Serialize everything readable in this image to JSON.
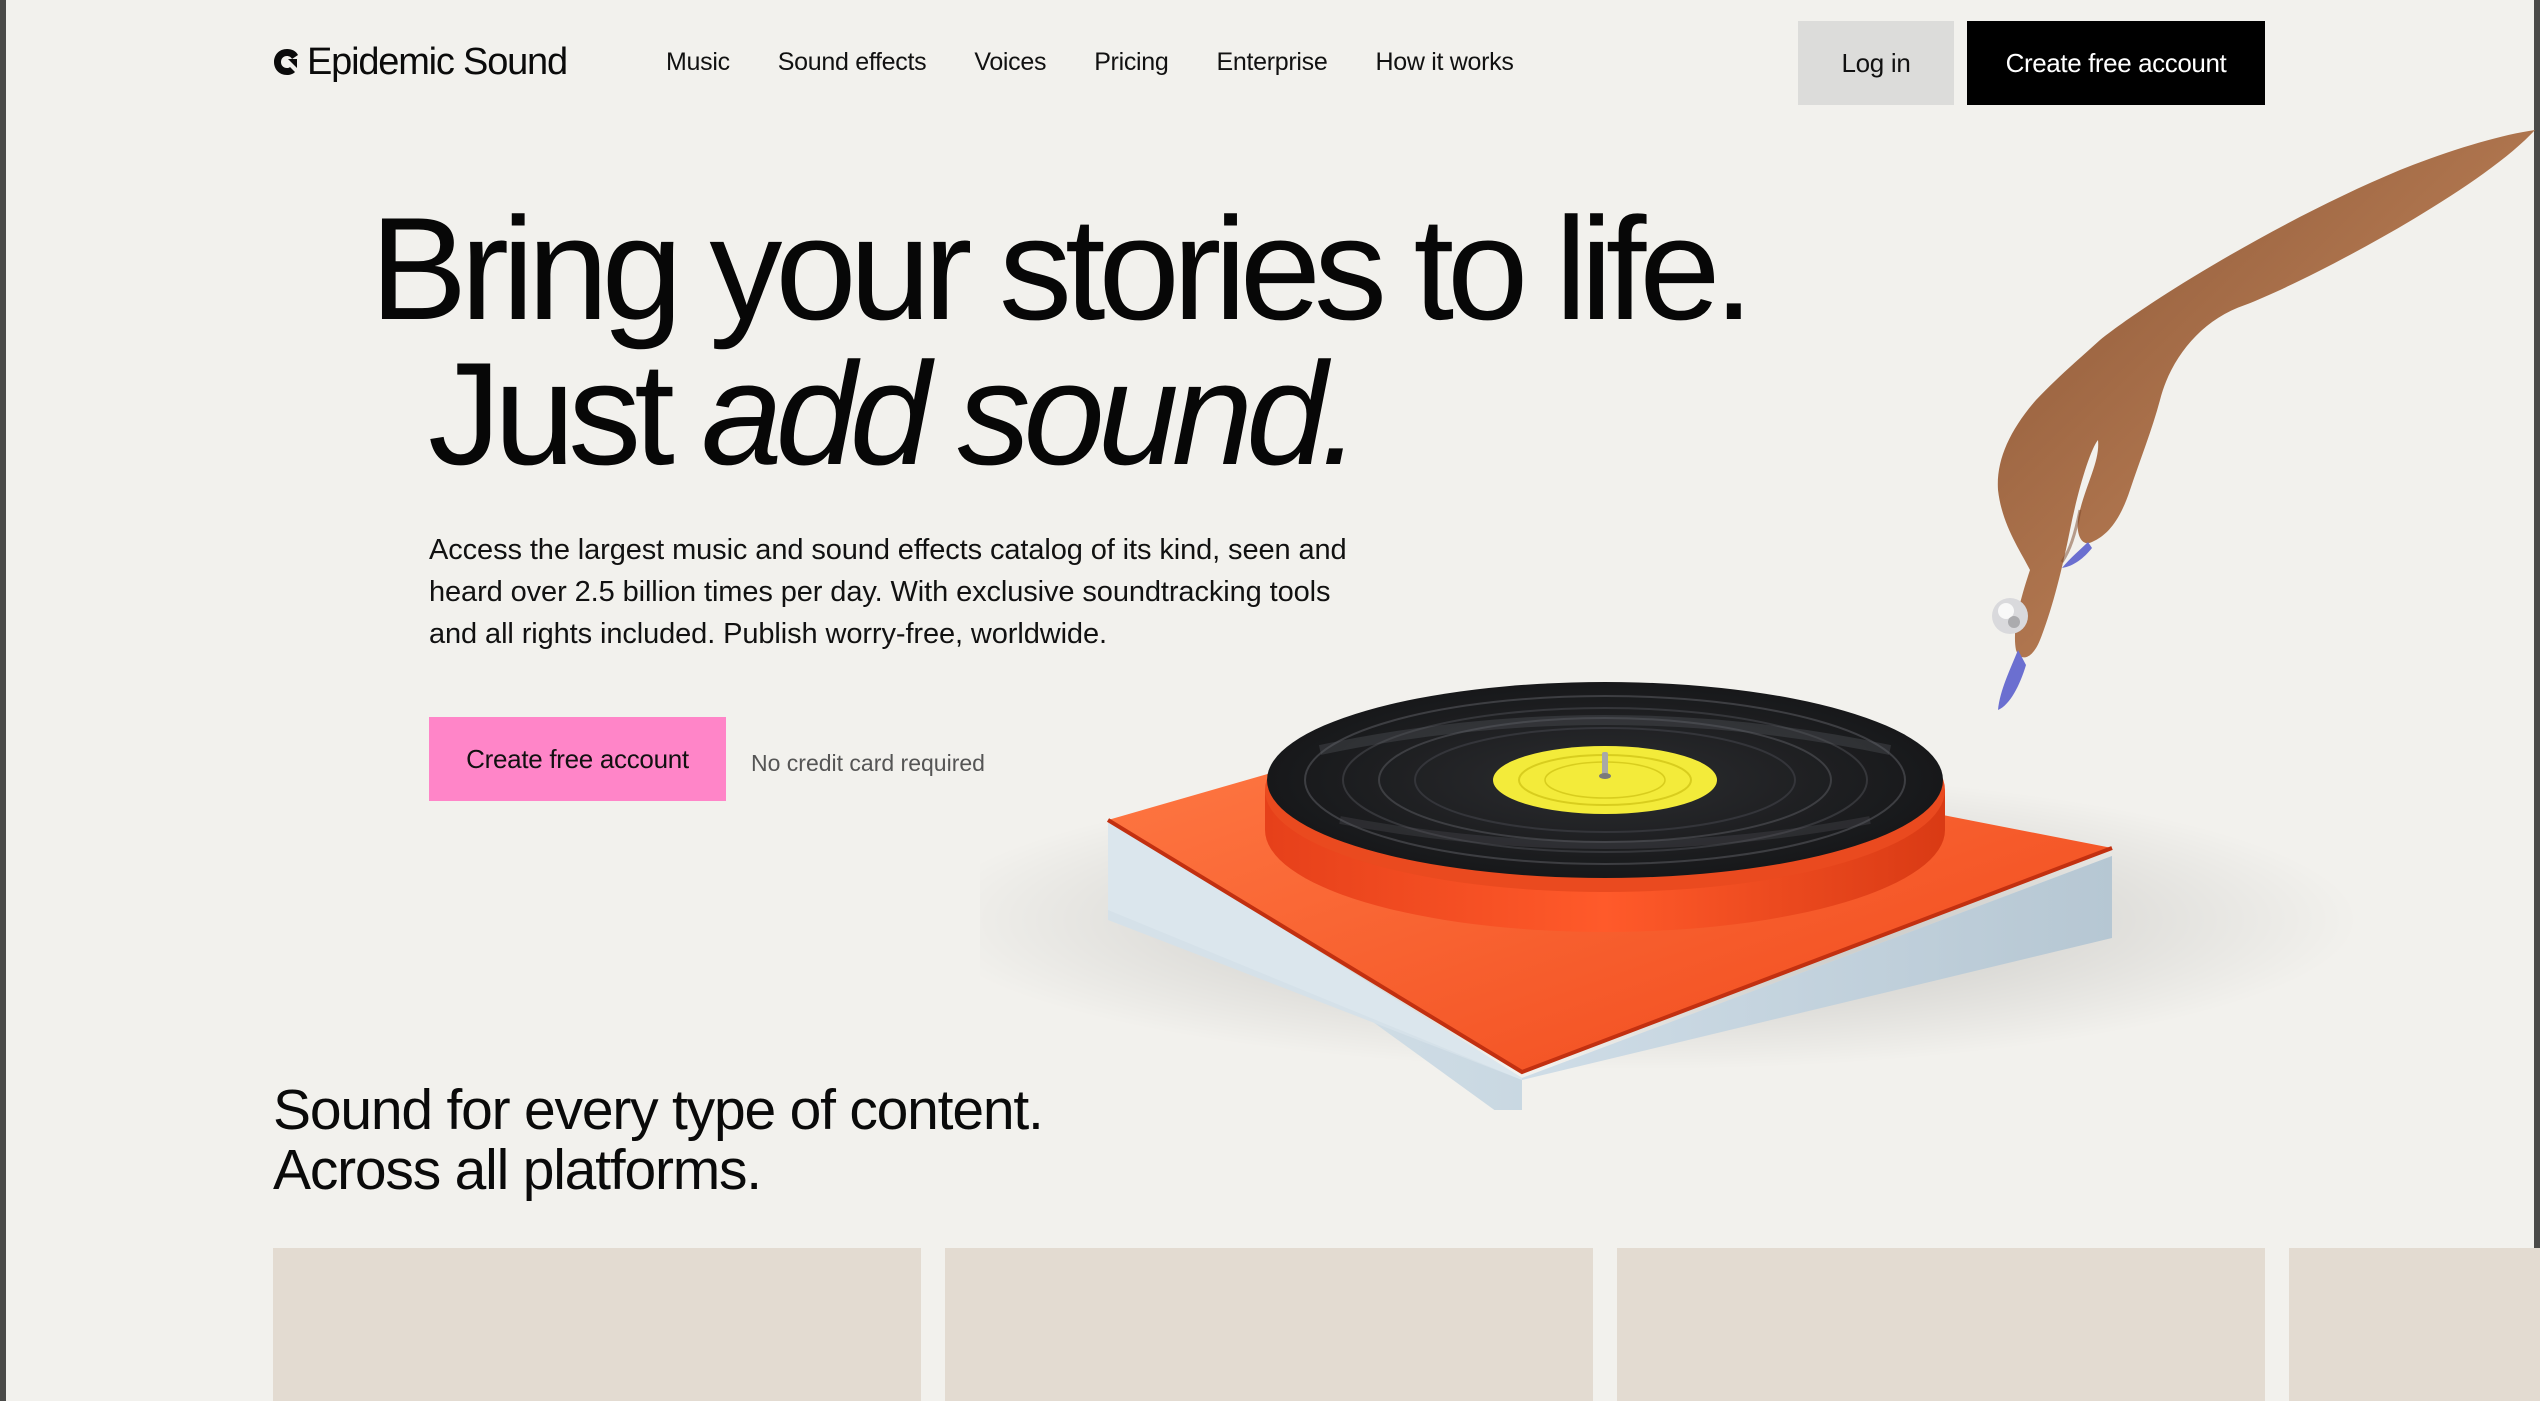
{
  "brand": {
    "name": "Epidemic Sound"
  },
  "nav": {
    "items": [
      {
        "label": "Music"
      },
      {
        "label": "Sound effects"
      },
      {
        "label": "Voices"
      },
      {
        "label": "Pricing"
      },
      {
        "label": "Enterprise"
      },
      {
        "label": "How it works"
      }
    ],
    "login_label": "Log in",
    "create_account_label": "Create free account"
  },
  "hero": {
    "title_line1": "Bring your stories to life.",
    "title_line2_plain": "Just ",
    "title_line2_italic": "add sound.",
    "description": "Access the largest music and sound effects catalog of its kind, seen and heard over 2.5 billion times per day. With exclusive soundtracking tools and all rights included. Publish worry-free, worldwide.",
    "cta_label": "Create free account",
    "cta_note": "No credit card required",
    "illustration": "turntable-with-hand-image"
  },
  "section": {
    "title_line1": "Sound for every type of content.",
    "title_line2": "Across all platforms."
  },
  "colors": {
    "background": "#f2f1ed",
    "primary_button": "#000000",
    "hero_cta": "#ff85c8",
    "login_button": "#dcdcda",
    "card": "#e3dbd1"
  }
}
